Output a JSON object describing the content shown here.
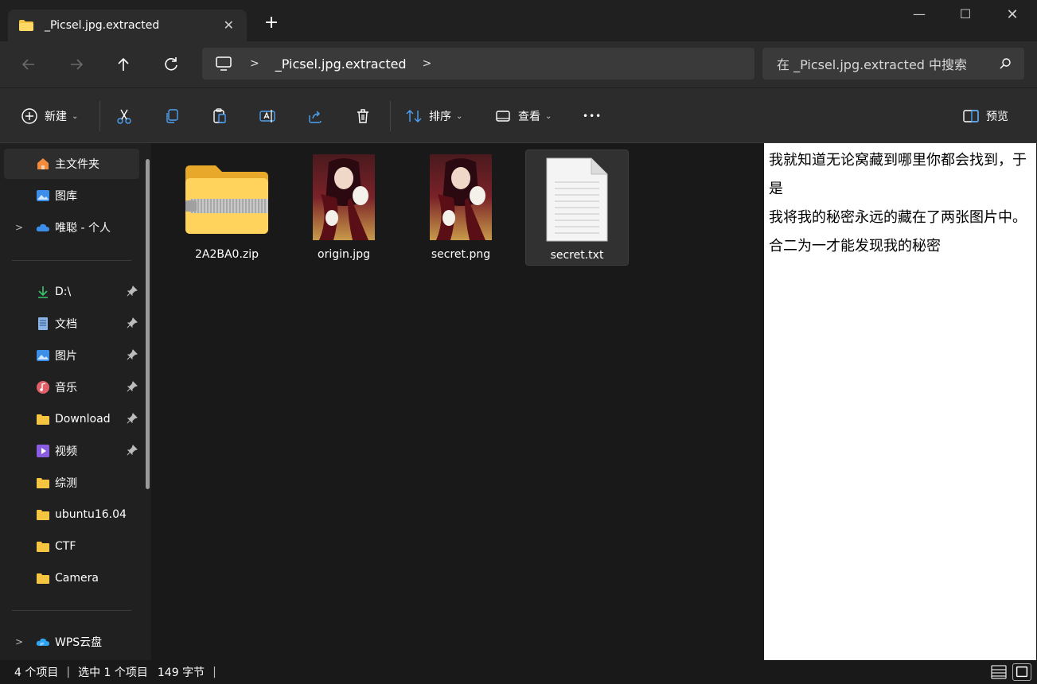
{
  "window": {
    "tab_title": "_Picsel.jpg.extracted",
    "new_tab": "+",
    "controls": {
      "minimize": "—",
      "maximize": "☐",
      "close": "✕"
    }
  },
  "nav": {
    "breadcrumb": "_Picsel.jpg.extracted",
    "search_placeholder": "在 _Picsel.jpg.extracted 中搜索"
  },
  "commands": {
    "new": "新建",
    "sort": "排序",
    "view": "查看",
    "more": "•••",
    "preview": "预览",
    "icons": [
      "cut-icon",
      "copy-icon",
      "paste-icon",
      "rename-icon",
      "share-icon",
      "delete-icon"
    ]
  },
  "sidebar": {
    "items": [
      {
        "label": "主文件夹",
        "icon": "home-icon"
      },
      {
        "label": "图库",
        "icon": "gallery-icon"
      },
      {
        "label": "唯聪 - 个人",
        "icon": "cloud-icon"
      },
      {
        "label": "D:\\",
        "icon": "download-arrow-icon"
      },
      {
        "label": "文档",
        "icon": "document-icon"
      },
      {
        "label": "图片",
        "icon": "pictures-icon"
      },
      {
        "label": "音乐",
        "icon": "music-icon"
      },
      {
        "label": "Download",
        "icon": "folder-icon"
      },
      {
        "label": "视频",
        "icon": "video-icon"
      },
      {
        "label": "综测",
        "icon": "folder-icon"
      },
      {
        "label": "ubuntu16.04",
        "icon": "folder-icon"
      },
      {
        "label": "CTF",
        "icon": "folder-icon"
      },
      {
        "label": "Camera",
        "icon": "folder-icon"
      },
      {
        "label": "WPS云盘",
        "icon": "wps-cloud-icon"
      }
    ]
  },
  "files": [
    {
      "name": "2A2BA0.zip",
      "type": "zip-folder"
    },
    {
      "name": "origin.jpg",
      "type": "image"
    },
    {
      "name": "secret.png",
      "type": "image"
    },
    {
      "name": "secret.txt",
      "type": "text",
      "selected": true
    }
  ],
  "preview": {
    "lines": [
      "我就知道无论窝藏到哪里你都会找到，于是",
      "我将我的秘密永远的藏在了两张图片中。合二为一才能发现我的秘密"
    ]
  },
  "status": {
    "count": "4 个项目",
    "selected": "选中 1 个项目",
    "size": "149 字节",
    "sep": "|"
  },
  "colors": {
    "window_bg": "#191919",
    "bar_bg": "#2c2c2c",
    "folder_yellow": "#f5c542",
    "accent_blue": "#4ea1f3"
  }
}
